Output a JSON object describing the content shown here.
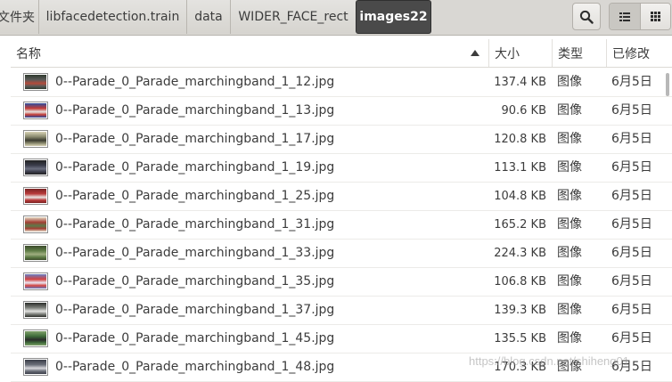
{
  "breadcrumbs": [
    {
      "label": "文件夹",
      "active": false
    },
    {
      "label": "libfacedetection.train",
      "active": false
    },
    {
      "label": "data",
      "active": false
    },
    {
      "label": "WIDER_FACE_rect",
      "active": false
    },
    {
      "label": "images22",
      "active": true
    }
  ],
  "toolbar": {
    "search_icon": "search-icon",
    "list_view_icon": "list-view-icon",
    "grid_view_icon": "grid-view-icon"
  },
  "columns": {
    "name": "名称",
    "size": "大小",
    "type": "类型",
    "modified": "已修改"
  },
  "files": [
    {
      "name": "0--Parade_0_Parade_marchingband_1_12.jpg",
      "size": "137.4 KB",
      "type": "图像",
      "modified": "6月5日",
      "thumb_colors": [
        "#5a5a58",
        "#b44a3a",
        "#2f3a2e"
      ]
    },
    {
      "name": "0--Parade_0_Parade_marchingband_1_13.jpg",
      "size": "90.6 KB",
      "type": "图像",
      "modified": "6月5日",
      "thumb_colors": [
        "#c23b35",
        "#e7e2df",
        "#2d4fa0"
      ]
    },
    {
      "name": "0--Parade_0_Parade_marchingband_1_17.jpg",
      "size": "120.8 KB",
      "type": "图像",
      "modified": "6月5日",
      "thumb_colors": [
        "#8a8a6e",
        "#3b3b30",
        "#d8d3b5"
      ]
    },
    {
      "name": "0--Parade_0_Parade_marchingband_1_19.jpg",
      "size": "113.1 KB",
      "type": "图像",
      "modified": "6月5日",
      "thumb_colors": [
        "#3a3c4a",
        "#6c6f80",
        "#222"
      ]
    },
    {
      "name": "0--Parade_0_Parade_marchingband_1_25.jpg",
      "size": "104.8 KB",
      "type": "图像",
      "modified": "6月5日",
      "thumb_colors": [
        "#b83a3a",
        "#e9e6e4",
        "#7a2424"
      ]
    },
    {
      "name": "0--Parade_0_Parade_marchingband_1_31.jpg",
      "size": "165.2 KB",
      "type": "图像",
      "modified": "6月5日",
      "thumb_colors": [
        "#a33f34",
        "#5c7a49",
        "#e3d9c4"
      ]
    },
    {
      "name": "0--Parade_0_Parade_marchingband_1_33.jpg",
      "size": "224.3 KB",
      "type": "图像",
      "modified": "6月5日",
      "thumb_colors": [
        "#5e7c46",
        "#9fae80",
        "#3c4b2c"
      ]
    },
    {
      "name": "0--Parade_0_Parade_marchingband_1_35.jpg",
      "size": "106.8 KB",
      "type": "图像",
      "modified": "6月5日",
      "thumb_colors": [
        "#d24340",
        "#eae7f2",
        "#6a7fc2"
      ]
    },
    {
      "name": "0--Parade_0_Parade_marchingband_1_37.jpg",
      "size": "139.3 KB",
      "type": "图像",
      "modified": "6月5日",
      "thumb_colors": [
        "#7c7f7a",
        "#e2e2e0",
        "#2b2d2a"
      ]
    },
    {
      "name": "0--Parade_0_Parade_marchingband_1_45.jpg",
      "size": "135.5 KB",
      "type": "图像",
      "modified": "6月5日",
      "thumb_colors": [
        "#3f6b3a",
        "#2b2b2b",
        "#7fa06a"
      ]
    },
    {
      "name": "0--Parade_0_Parade_marchingband_1_48.jpg",
      "size": "170.3 KB",
      "type": "图像",
      "modified": "6月5日",
      "thumb_colors": [
        "#6a6e78",
        "#d8d8dc",
        "#3a3d48"
      ]
    }
  ],
  "watermark": "https://blog.csdn.net/shiheng01"
}
